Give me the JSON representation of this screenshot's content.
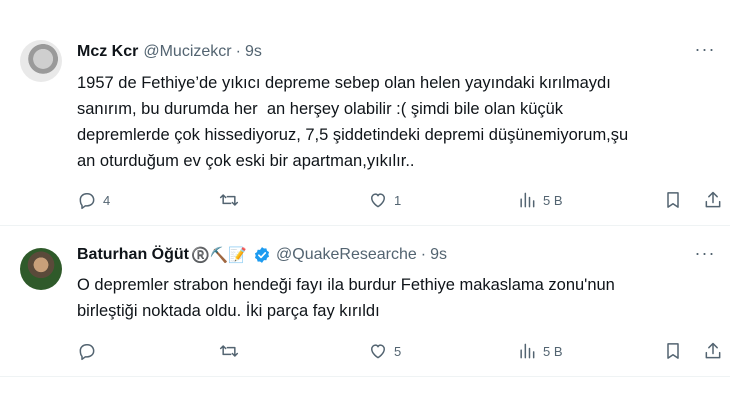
{
  "tweets": [
    {
      "author_name": "Mcz Kcr",
      "handle": "@Mucizekcr",
      "separator": "·",
      "time": "9s",
      "text": "1957 de Fethiye’de yıkıcı depreme sebep olan helen yayındaki kırılmaydı\nsanırım, bu durumda her  an herşey olabilir :( şimdi bile olan küçük\ndepremlerde çok hissediyoruz, 7,5 şiddetindeki depremi düşünemiyorum,şu\nan oturduğum ev çok eski bir apartman,yıkılır..",
      "reply_count": "4",
      "retweet_count": "",
      "like_count": "1",
      "view_count": "5 B"
    },
    {
      "author_name": "Baturhan Öğüt",
      "name_emoji": "®️⛏️📝",
      "verified": true,
      "handle": "@QuakeResearche",
      "separator": "·",
      "time": "9s",
      "text": "O depremler strabon hendeği fayı ila burdur Fethiye makaslama zonu'nun\nbirleştiği noktada oldu. İki parça fay kırıldı",
      "reply_count": "",
      "retweet_count": "",
      "like_count": "5",
      "view_count": "5 B"
    }
  ],
  "colors": {
    "text": "#0f1419",
    "muted": "#536471",
    "verified": "#1d9bf0",
    "divider": "#eff3f4"
  },
  "icons": [
    "reply-icon",
    "retweet-icon",
    "like-icon",
    "views-icon",
    "bookmark-icon",
    "share-icon",
    "more-icon",
    "verified-badge-icon"
  ]
}
